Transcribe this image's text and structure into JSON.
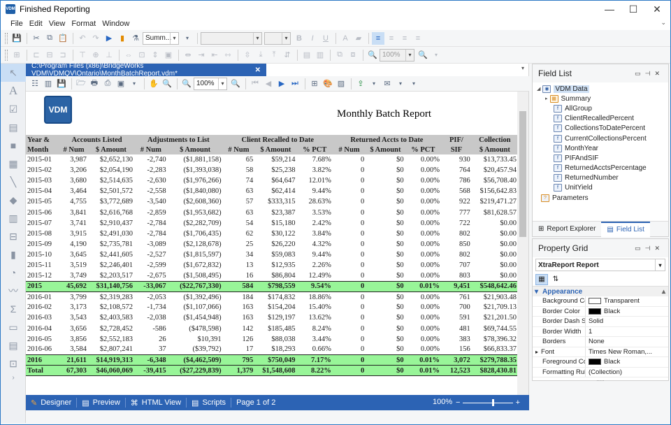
{
  "window": {
    "title": "Finished Reporting",
    "app_icon": "VDM"
  },
  "menu": [
    "File",
    "Edit",
    "View",
    "Format",
    "Window"
  ],
  "toolbar": {
    "font_combo": "Summ...",
    "zoom_value": "100%"
  },
  "document": {
    "tab_title": "C:\\Program Files (x86)\\BridgeWorks VDM\\VDMQV\\Ontario\\MonthBatchReport.vdm*",
    "close": "✕",
    "zoom": "100%"
  },
  "report": {
    "logo": "VDM",
    "title": "Monthly Batch Report",
    "header_groups": [
      "Year &",
      "Accounts Listed",
      "Adjustments to List",
      "Client Recalled to Date",
      "Returned Accts to Date",
      "PIF/",
      "Collection"
    ],
    "header_cols": [
      "Month",
      "# Num",
      "$ Amount",
      "# Num",
      "$ Amount",
      "# Num",
      "$ Amount",
      "% PCT",
      "# Num",
      "$ Amount",
      "% PCT",
      "SIF",
      "$ Amount"
    ],
    "rows": [
      [
        "2015-01",
        "3,987",
        "$2,652,130",
        "-2,740",
        "($1,881,158)",
        "65",
        "$59,214",
        "7.68%",
        "0",
        "$0",
        "0.00%",
        "930",
        "$13,733.45"
      ],
      [
        "2015-02",
        "3,206",
        "$2,054,190",
        "-2,283",
        "($1,393,038)",
        "58",
        "$25,238",
        "3.82%",
        "0",
        "$0",
        "0.00%",
        "764",
        "$20,457.94"
      ],
      [
        "2015-03",
        "3,680",
        "$2,514,635",
        "-2,630",
        "($1,976,266)",
        "74",
        "$64,647",
        "12.01%",
        "0",
        "$0",
        "0.00%",
        "786",
        "$56,708.40"
      ],
      [
        "2015-04",
        "3,464",
        "$2,501,572",
        "-2,558",
        "($1,840,080)",
        "63",
        "$62,414",
        "9.44%",
        "0",
        "$0",
        "0.00%",
        "568",
        "$156,642.83"
      ],
      [
        "2015-05",
        "4,755",
        "$3,772,689",
        "-3,540",
        "($2,608,360)",
        "57",
        "$333,315",
        "28.63%",
        "0",
        "$0",
        "0.00%",
        "922",
        "$219,471.27"
      ],
      [
        "2015-06",
        "3,841",
        "$2,616,768",
        "-2,859",
        "($1,953,682)",
        "63",
        "$23,387",
        "3.53%",
        "0",
        "$0",
        "0.00%",
        "777",
        "$81,628.57"
      ],
      [
        "2015-07",
        "3,741",
        "$2,910,437",
        "-2,784",
        "($2,282,709)",
        "54",
        "$15,180",
        "2.42%",
        "0",
        "$0",
        "0.00%",
        "722",
        "$0.00"
      ],
      [
        "2015-08",
        "3,915",
        "$2,491,030",
        "-2,784",
        "($1,706,435)",
        "62",
        "$30,122",
        "3.84%",
        "0",
        "$0",
        "0.00%",
        "802",
        "$0.00"
      ],
      [
        "2015-09",
        "4,190",
        "$2,735,781",
        "-3,089",
        "($2,128,678)",
        "25",
        "$26,220",
        "4.32%",
        "0",
        "$0",
        "0.00%",
        "850",
        "$0.00"
      ],
      [
        "2015-10",
        "3,645",
        "$2,441,605",
        "-2,527",
        "($1,815,597)",
        "34",
        "$59,083",
        "9.44%",
        "0",
        "$0",
        "0.00%",
        "802",
        "$0.00"
      ],
      [
        "2015-11",
        "3,519",
        "$2,246,401",
        "-2,599",
        "($1,672,832)",
        "13",
        "$12,935",
        "2.26%",
        "0",
        "$0",
        "0.00%",
        "707",
        "$0.00"
      ],
      [
        "2015-12",
        "3,749",
        "$2,203,517",
        "-2,675",
        "($1,508,495)",
        "16",
        "$86,804",
        "12.49%",
        "0",
        "$0",
        "0.00%",
        "803",
        "$0.00"
      ],
      {
        "sub": true,
        "cells": [
          "2015",
          "45,692",
          "$31,140,756",
          "-33,067",
          "($22,767,330)",
          "584",
          "$798,559",
          "9.54%",
          "0",
          "$0",
          "0.01%",
          "9,451",
          "$548,642.46"
        ]
      },
      [
        "2016-01",
        "3,799",
        "$2,319,283",
        "-2,053",
        "($1,392,496)",
        "184",
        "$174,832",
        "18.86%",
        "0",
        "$0",
        "0.00%",
        "761",
        "$21,903.48"
      ],
      [
        "2016-02",
        "3,173",
        "$2,108,572",
        "-1,734",
        "($1,107,066)",
        "163",
        "$154,204",
        "15.40%",
        "0",
        "$0",
        "0.00%",
        "700",
        "$21,709.13"
      ],
      [
        "2016-03",
        "3,543",
        "$2,403,583",
        "-2,038",
        "($1,454,948)",
        "163",
        "$129,197",
        "13.62%",
        "0",
        "$0",
        "0.00%",
        "591",
        "$21,201.50"
      ],
      [
        "2016-04",
        "3,656",
        "$2,728,452",
        "-586",
        "($478,598)",
        "142",
        "$185,485",
        "8.24%",
        "0",
        "$0",
        "0.00%",
        "481",
        "$69,744.55"
      ],
      [
        "2016-05",
        "3,856",
        "$2,552,183",
        "26",
        "$10,391",
        "126",
        "$88,038",
        "3.44%",
        "0",
        "$0",
        "0.00%",
        "383",
        "$78,396.32"
      ],
      [
        "2016-06",
        "3,584",
        "$2,807,241",
        "37",
        "($39,792)",
        "17",
        "$18,293",
        "0.66%",
        "0",
        "$0",
        "0.00%",
        "156",
        "$66,833.37"
      ],
      {
        "sub": true,
        "cells": [
          "2016",
          "21,611",
          "$14,919,313",
          "-6,348",
          "($4,462,509)",
          "795",
          "$750,049",
          "7.17%",
          "0",
          "$0",
          "0.01%",
          "3,072",
          "$279,788.35"
        ]
      },
      {
        "sub": true,
        "cells": [
          "Total",
          "67,303",
          "$46,060,069",
          "-39,415",
          "($27,229,839)",
          "1,379",
          "$1,548,608",
          "8.22%",
          "0",
          "$0",
          "0.01%",
          "12,523",
          "$828,430.81"
        ]
      }
    ]
  },
  "statusbar": {
    "designer": "Designer",
    "preview": "Preview",
    "html_view": "HTML View",
    "scripts": "Scripts",
    "page": "Page 1 of 2",
    "zoom": "100%"
  },
  "field_list": {
    "title": "Field List",
    "items": [
      {
        "label": "VDM Data",
        "icon": "db"
      },
      {
        "label": "Summary",
        "icon": "table"
      },
      {
        "label": "AllGroup",
        "icon": "f"
      },
      {
        "label": "ClientRecalledPercent",
        "icon": "f"
      },
      {
        "label": "CollectionsToDatePercent",
        "icon": "f"
      },
      {
        "label": "CurrentCollectionsPercent",
        "icon": "f"
      },
      {
        "label": "MonthYear",
        "icon": "f"
      },
      {
        "label": "PIFAndSIF",
        "icon": "f"
      },
      {
        "label": "ReturnedAcctsPercentage",
        "icon": "f"
      },
      {
        "label": "ReturnedNumber",
        "icon": "f"
      },
      {
        "label": "UnitYield",
        "icon": "f"
      },
      {
        "label": "Parameters",
        "icon": "param"
      }
    ],
    "tab_report_explorer": "Report Explorer",
    "tab_field_list": "Field List"
  },
  "property_grid": {
    "title": "Property Grid",
    "selected": "XtraReport Report",
    "category": "Appearance",
    "props": [
      {
        "name": "Background Colo",
        "value": "Transparent",
        "swatch": "#ffffff"
      },
      {
        "name": "Border Color",
        "value": "Black",
        "swatch": "#000000"
      },
      {
        "name": "Border Dash Sty",
        "value": "Solid"
      },
      {
        "name": "Border Width",
        "value": "1"
      },
      {
        "name": "Borders",
        "value": "None"
      },
      {
        "name": "Font",
        "value": "Times New Roman,..."
      },
      {
        "name": "Foreground Colo",
        "value": "Black",
        "swatch": "#000000"
      },
      {
        "name": "Formatting Rule",
        "value": "(Collection)"
      }
    ]
  },
  "colors": {
    "accent": "#2c63b4",
    "subtotal": "#98f598",
    "header": "#c8c8c8"
  }
}
